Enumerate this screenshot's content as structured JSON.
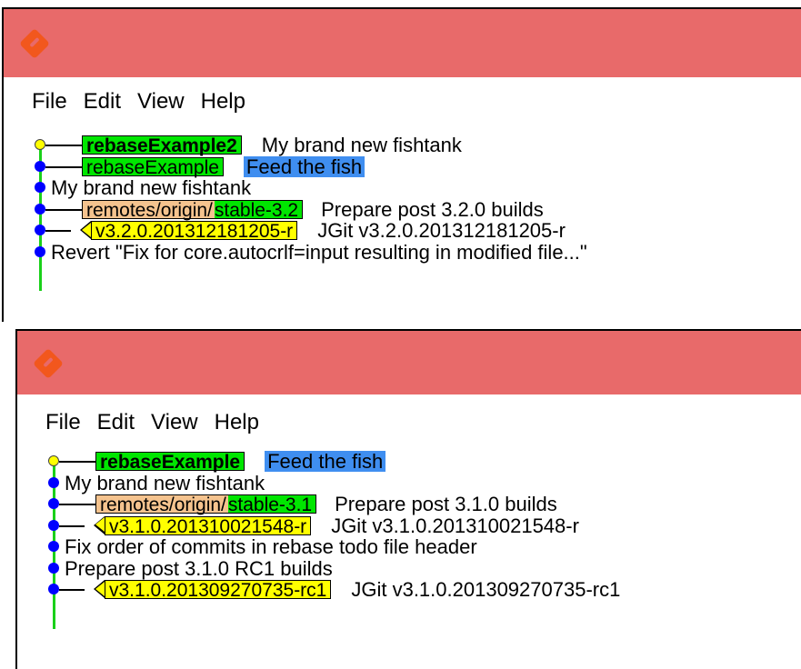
{
  "windows": [
    {
      "id": "top",
      "menu": [
        "File",
        "Edit",
        "View",
        "Help"
      ],
      "rows": [
        {
          "type": "head-branch",
          "refs": [
            {
              "kind": "branch",
              "label": "rebaseExample2",
              "current": true
            }
          ],
          "message": "My brand new fishtank"
        },
        {
          "type": "commit",
          "refs": [
            {
              "kind": "branch",
              "label": "rebaseExample"
            }
          ],
          "message": "Feed the fish",
          "message_highlight": true
        },
        {
          "type": "commit",
          "refs": [],
          "message": "My brand new fishtank"
        },
        {
          "type": "commit",
          "refs": [
            {
              "kind": "remote",
              "prefix": "remotes/origin/",
              "suffix": "stable-3.2"
            }
          ],
          "message": "Prepare post 3.2.0 builds"
        },
        {
          "type": "commit",
          "refs": [
            {
              "kind": "tag",
              "label": "v3.2.0.201312181205-r"
            }
          ],
          "message": "JGit v3.2.0.201312181205-r"
        },
        {
          "type": "commit",
          "refs": [],
          "message": "Revert \"Fix for core.autocrlf=input resulting in modified file...\""
        }
      ]
    },
    {
      "id": "bottom",
      "menu": [
        "File",
        "Edit",
        "View",
        "Help"
      ],
      "rows": [
        {
          "type": "head-branch",
          "refs": [
            {
              "kind": "branch",
              "label": "rebaseExample",
              "current": true
            }
          ],
          "message": "Feed the fish",
          "message_highlight": true
        },
        {
          "type": "commit",
          "refs": [],
          "message": "My brand new fishtank"
        },
        {
          "type": "commit",
          "refs": [
            {
              "kind": "remote",
              "prefix": "remotes/origin/",
              "suffix": "stable-3.1"
            }
          ],
          "message": "Prepare post 3.1.0 builds"
        },
        {
          "type": "commit",
          "refs": [
            {
              "kind": "tag",
              "label": "v3.1.0.201310021548-r"
            }
          ],
          "message": "JGit v3.1.0.201310021548-r"
        },
        {
          "type": "commit",
          "refs": [],
          "message": "Fix order of commits in rebase todo file header"
        },
        {
          "type": "commit",
          "refs": [],
          "message": "Prepare post 3.1.0 RC1 builds"
        },
        {
          "type": "commit",
          "refs": [
            {
              "kind": "tag",
              "label": "v3.1.0.201309270735-rc1"
            }
          ],
          "message": "JGit v3.1.0.201309270735-rc1"
        }
      ]
    }
  ],
  "colors": {
    "titlebar": "#e86a6a",
    "branch": "#00e600",
    "remote_prefix": "#f5c38e",
    "tag": "#ffff00",
    "message_highlight": "#3f8ef0",
    "graph_line": "#1ad01a",
    "commit_dot": "#0000ff",
    "head_dot": "#ffff00"
  },
  "icons": {
    "app": "git-logo-icon",
    "commit": "commit-dot-icon",
    "tag": "tag-arrow-icon"
  }
}
